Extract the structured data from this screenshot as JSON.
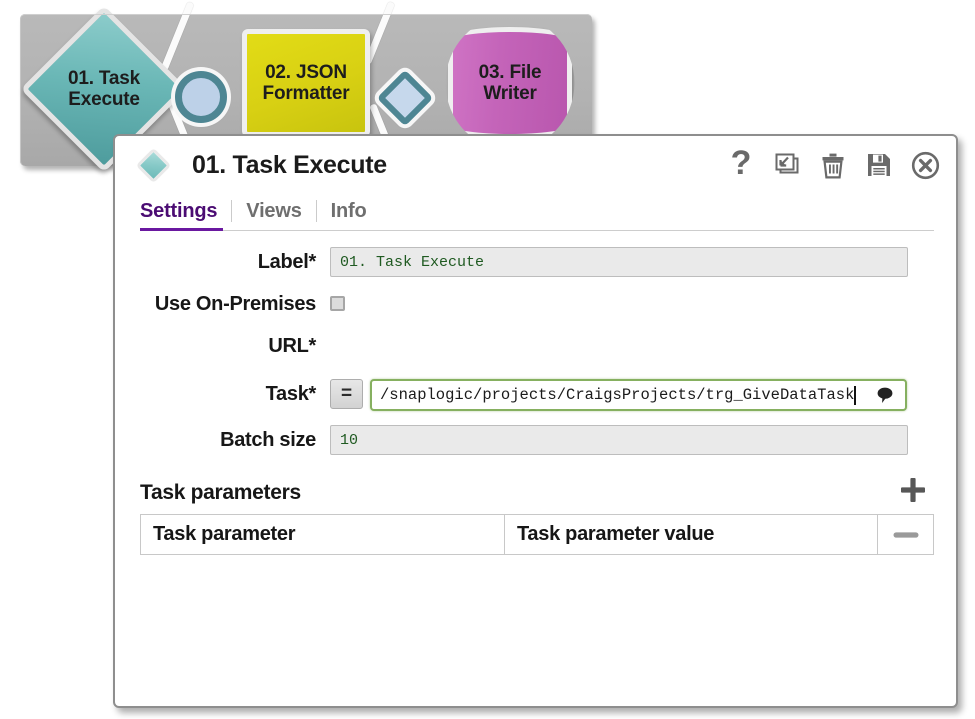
{
  "pipeline": {
    "nodes": [
      {
        "id": "task-execute",
        "label": "01. Task\nExecute",
        "shape": "diamond",
        "color": "#6ab7b6"
      },
      {
        "id": "connector-1",
        "label": "",
        "shape": "circle",
        "color": "#bdd1e8"
      },
      {
        "id": "json-formatter",
        "label": "02. JSON\nFormatter",
        "shape": "square",
        "color": "#d8d013"
      },
      {
        "id": "connector-2",
        "label": "",
        "shape": "small-diamond",
        "color": "#c6d8ec"
      },
      {
        "id": "file-writer",
        "label": "03. File\nWriter",
        "shape": "cylinder",
        "color": "#c464b9"
      }
    ]
  },
  "dialog": {
    "icon": "diamond-snap-icon",
    "title": "01. Task Execute",
    "titlebar_actions": [
      {
        "name": "help-icon",
        "glyph": "?",
        "tooltip": "Help"
      },
      {
        "name": "restore-icon",
        "glyph": "window",
        "tooltip": "Restore"
      },
      {
        "name": "delete-icon",
        "glyph": "trash",
        "tooltip": "Delete"
      },
      {
        "name": "save-icon",
        "glyph": "floppy",
        "tooltip": "Save"
      },
      {
        "name": "close-icon",
        "glyph": "circle-x",
        "tooltip": "Close"
      }
    ],
    "tabs": [
      {
        "label": "Settings",
        "active": true
      },
      {
        "label": "Views",
        "active": false
      },
      {
        "label": "Info",
        "active": false
      }
    ],
    "accent_color": "#6a18a0",
    "fields": {
      "label": {
        "label": "Label*",
        "value": "01. Task Execute",
        "placeholder": ""
      },
      "use_on_premises": {
        "label": "Use On-Premises",
        "checked": false
      },
      "url": {
        "label": "URL*",
        "value": "",
        "placeholder": ""
      },
      "task": {
        "label": "Task*",
        "expression_toggle": "=",
        "value": "/snaplogic/projects/CraigsProjects/trg_GiveDataTask",
        "placeholder": "",
        "focused": true,
        "border_color": "#86b060",
        "suggest_icon": "balloon-icon"
      },
      "batch_size": {
        "label": "Batch size",
        "value": "10",
        "placeholder": ""
      }
    },
    "task_parameters": {
      "title": "Task parameters",
      "add_label": "+",
      "remove_label": "−",
      "columns": [
        "Task parameter",
        "Task parameter value"
      ],
      "rows": []
    }
  }
}
